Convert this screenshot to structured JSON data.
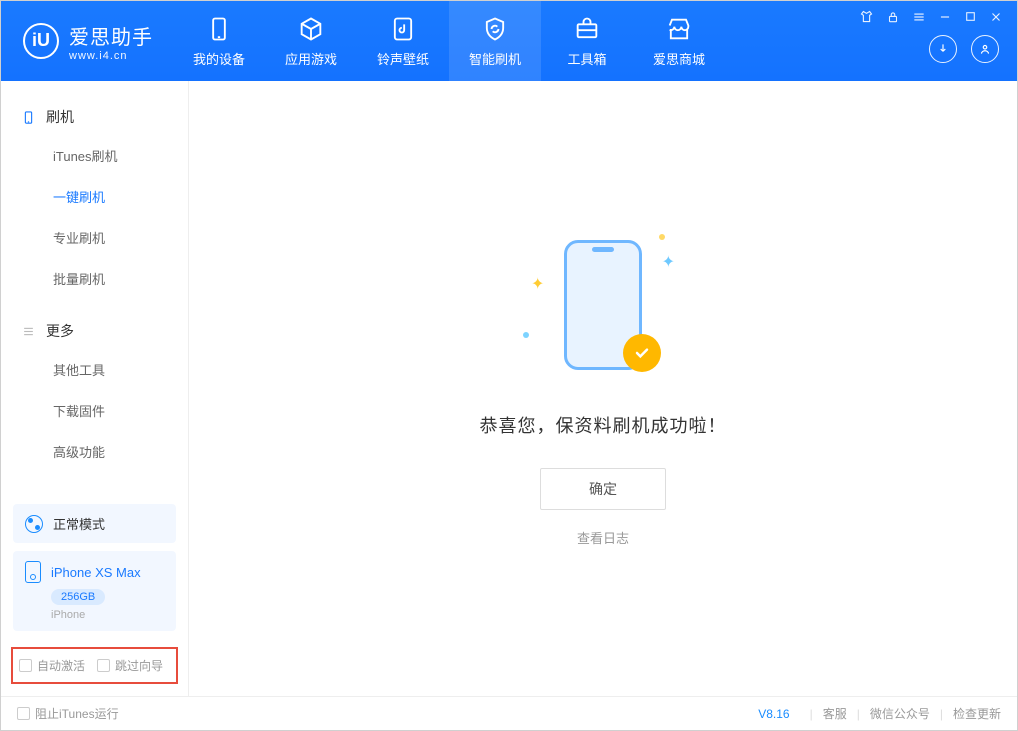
{
  "app": {
    "name": "爱思助手",
    "url": "www.i4.cn"
  },
  "tabs": [
    {
      "id": "device",
      "label": "我的设备"
    },
    {
      "id": "apps",
      "label": "应用游戏"
    },
    {
      "id": "ringtone",
      "label": "铃声壁纸"
    },
    {
      "id": "flash",
      "label": "智能刷机",
      "active": true
    },
    {
      "id": "toolbox",
      "label": "工具箱"
    },
    {
      "id": "store",
      "label": "爱思商城"
    }
  ],
  "sidebar": {
    "section1": {
      "title": "刷机",
      "items": [
        {
          "id": "itunes",
          "label": "iTunes刷机"
        },
        {
          "id": "onekey",
          "label": "一键刷机",
          "active": true
        },
        {
          "id": "pro",
          "label": "专业刷机"
        },
        {
          "id": "batch",
          "label": "批量刷机"
        }
      ]
    },
    "section2": {
      "title": "更多",
      "items": [
        {
          "id": "other",
          "label": "其他工具"
        },
        {
          "id": "firmware",
          "label": "下载固件"
        },
        {
          "id": "advanced",
          "label": "高级功能"
        }
      ]
    }
  },
  "device": {
    "mode": "正常模式",
    "name": "iPhone XS Max",
    "capacity": "256GB",
    "type": "iPhone"
  },
  "options": {
    "auto_activate": "自动激活",
    "skip_guide": "跳过向导"
  },
  "main": {
    "success_msg": "恭喜您，保资料刷机成功啦！",
    "ok_btn": "确定",
    "log_link": "查看日志"
  },
  "footer": {
    "block_itunes": "阻止iTunes运行",
    "version": "V8.16",
    "support": "客服",
    "wechat": "微信公众号",
    "update": "检查更新"
  }
}
